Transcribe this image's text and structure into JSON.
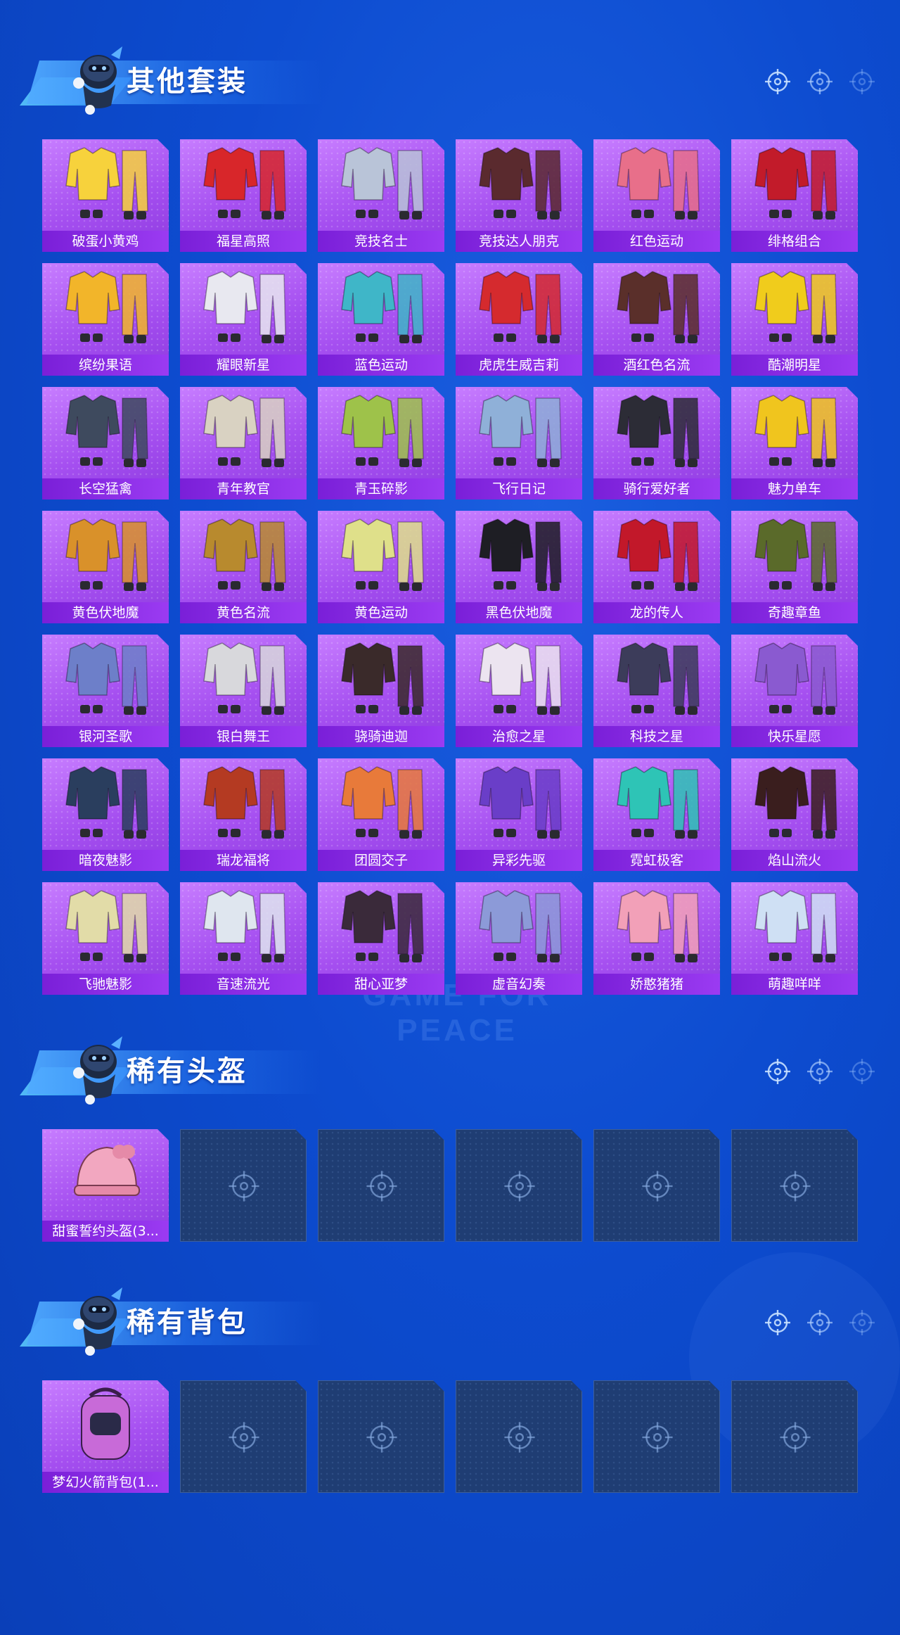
{
  "sections": [
    {
      "title": "其他套装",
      "items": [
        {
          "label": "破蛋小黄鸡",
          "color": "#f7d23c"
        },
        {
          "label": "福星高照",
          "color": "#d8262a"
        },
        {
          "label": "竞技名士",
          "color": "#b9c4d8"
        },
        {
          "label": "竞技达人朋克",
          "color": "#5a2a2e"
        },
        {
          "label": "红色运动",
          "color": "#e86f8a"
        },
        {
          "label": "绯格组合",
          "color": "#c21b2a"
        },
        {
          "label": "缤纷果语",
          "color": "#f2b52a"
        },
        {
          "label": "耀眼新星",
          "color": "#e8e8f0"
        },
        {
          "label": "蓝色运动",
          "color": "#3fb6c8"
        },
        {
          "label": "虎虎生威吉莉",
          "color": "#d52a2e"
        },
        {
          "label": "酒红色名流",
          "color": "#5a2f2a"
        },
        {
          "label": "酷潮明星",
          "color": "#f0cc1c"
        },
        {
          "label": "长空猛禽",
          "color": "#3e4a5e"
        },
        {
          "label": "青年教官",
          "color": "#d9d2c2"
        },
        {
          "label": "青玉碎影",
          "color": "#9ec24a"
        },
        {
          "label": "飞行日记",
          "color": "#8fb0d8"
        },
        {
          "label": "骑行爱好者",
          "color": "#2c2c36"
        },
        {
          "label": "魅力单车",
          "color": "#f0c51e"
        },
        {
          "label": "黄色伏地魔",
          "color": "#d9912a"
        },
        {
          "label": "黄色名流",
          "color": "#b88a2e"
        },
        {
          "label": "黄色运动",
          "color": "#dfe08a"
        },
        {
          "label": "黑色伏地魔",
          "color": "#1e1e24"
        },
        {
          "label": "龙的传人",
          "color": "#c2182a"
        },
        {
          "label": "奇趣章鱼",
          "color": "#5a6a2a"
        },
        {
          "label": "银河圣歌",
          "color": "#6d7fc9"
        },
        {
          "label": "银白舞王",
          "color": "#d8d8dc"
        },
        {
          "label": "骁骑迪迦",
          "color": "#3a2a2a"
        },
        {
          "label": "治愈之星",
          "color": "#ece4f0"
        },
        {
          "label": "科技之星",
          "color": "#3c3c5a"
        },
        {
          "label": "快乐星愿",
          "color": "#8a5ad0"
        },
        {
          "label": "暗夜魅影",
          "color": "#2a3e5e"
        },
        {
          "label": "瑞龙福将",
          "color": "#b43a22"
        },
        {
          "label": "团圆交子",
          "color": "#e87a3a"
        },
        {
          "label": "异彩先驱",
          "color": "#6a3ec8"
        },
        {
          "label": "霓虹极客",
          "color": "#2ec4b6"
        },
        {
          "label": "焰山流火",
          "color": "#3a1e1e"
        },
        {
          "label": "飞驰魅影",
          "color": "#e2dca8"
        },
        {
          "label": "音速流光",
          "color": "#dfe6ef"
        },
        {
          "label": "甜心亚梦",
          "color": "#3a2a3a"
        },
        {
          "label": "虚音幻奏",
          "color": "#8c9ad8"
        },
        {
          "label": "娇憨猪猪",
          "color": "#f2a0b8"
        },
        {
          "label": "萌趣咩咩",
          "color": "#cfe0f4"
        }
      ]
    },
    {
      "title": "稀有头盔",
      "items": [
        {
          "label": "甜蜜誓约头盔(3...",
          "color": "#f2a7c0"
        }
      ],
      "empty_slots": 5
    },
    {
      "title": "稀有背包",
      "items": [
        {
          "label": "梦幻火箭背包(1...",
          "color": "#c86ad8"
        }
      ],
      "empty_slots": 5
    }
  ],
  "watermark": "GAME FOR PEACE",
  "icons": {
    "header_decoration": "crosshair-icon",
    "empty_slot": "crosshair-icon",
    "mascot": "mascot-icon"
  }
}
